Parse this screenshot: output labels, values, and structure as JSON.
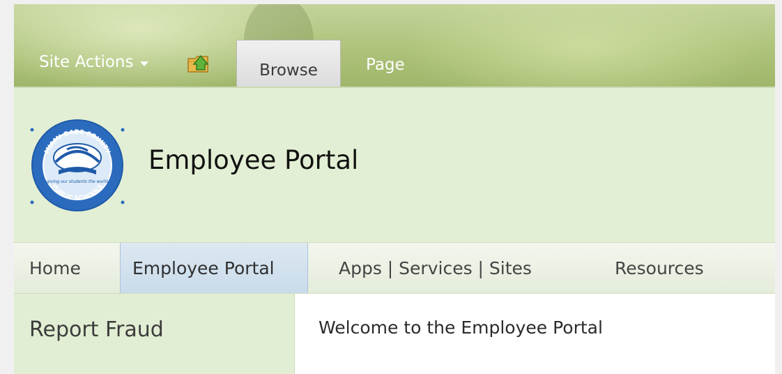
{
  "ribbon": {
    "site_actions_label": "Site Actions",
    "tabs": [
      {
        "label": "Browse",
        "selected": true
      },
      {
        "label": "Page",
        "selected": false
      }
    ]
  },
  "site": {
    "title": "Employee Portal",
    "logo": {
      "text_top": "MIAMI-DADE COUNTY",
      "text_mid": "giving our students the world",
      "text_bottom": "PUBLIC SCHOOLS"
    }
  },
  "topnav": {
    "items": [
      {
        "label": "Home",
        "selected": false
      },
      {
        "label": "Employee Portal",
        "selected": true
      },
      {
        "label": "Apps | Services | Sites",
        "selected": false
      },
      {
        "label": "Resources",
        "selected": false
      }
    ]
  },
  "leftnav": {
    "items": [
      {
        "label": "Report Fraud"
      }
    ]
  },
  "content": {
    "welcome_text": "Welcome to the Employee Portal"
  },
  "colors": {
    "ribbon": "#aec37a",
    "title_area": "#e3efd4",
    "selected_nav": "#c9dbea",
    "content_bg": "#ffffff"
  }
}
